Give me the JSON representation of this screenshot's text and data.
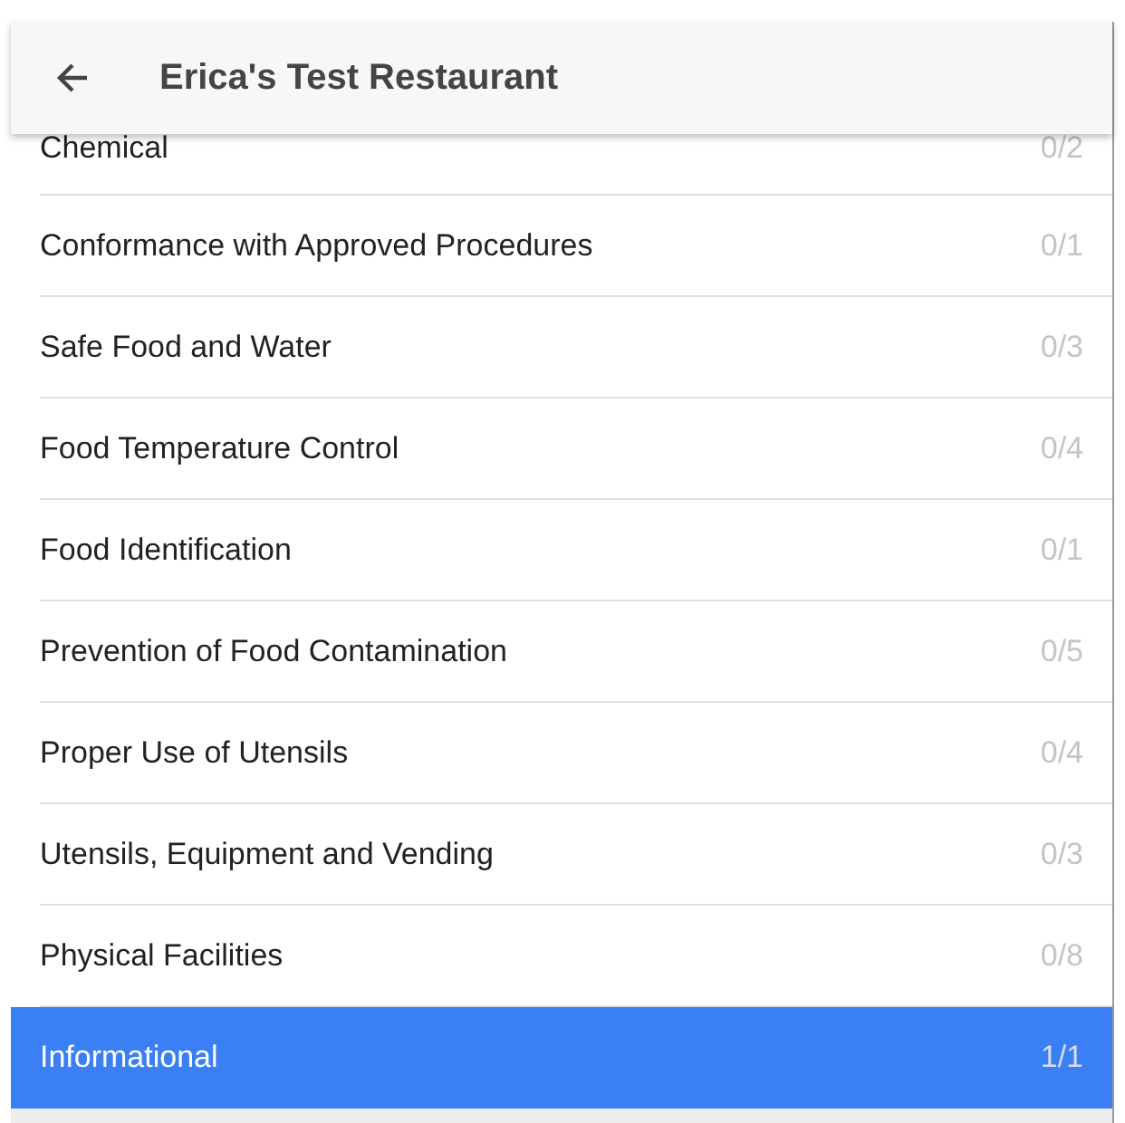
{
  "header": {
    "title": "Erica's Test Restaurant"
  },
  "categories": [
    {
      "name": "Chemical",
      "count": "0/2",
      "selected": false
    },
    {
      "name": "Conformance with Approved Procedures",
      "count": "0/1",
      "selected": false
    },
    {
      "name": "Safe Food and Water",
      "count": "0/3",
      "selected": false
    },
    {
      "name": "Food Temperature Control",
      "count": "0/4",
      "selected": false
    },
    {
      "name": "Food Identification",
      "count": "0/1",
      "selected": false
    },
    {
      "name": "Prevention of Food Contamination",
      "count": "0/5",
      "selected": false
    },
    {
      "name": "Proper Use of Utensils",
      "count": "0/4",
      "selected": false
    },
    {
      "name": "Utensils, Equipment and Vending",
      "count": "0/3",
      "selected": false
    },
    {
      "name": "Physical Facilities",
      "count": "0/8",
      "selected": false
    },
    {
      "name": "Informational",
      "count": "1/1",
      "selected": true
    }
  ]
}
